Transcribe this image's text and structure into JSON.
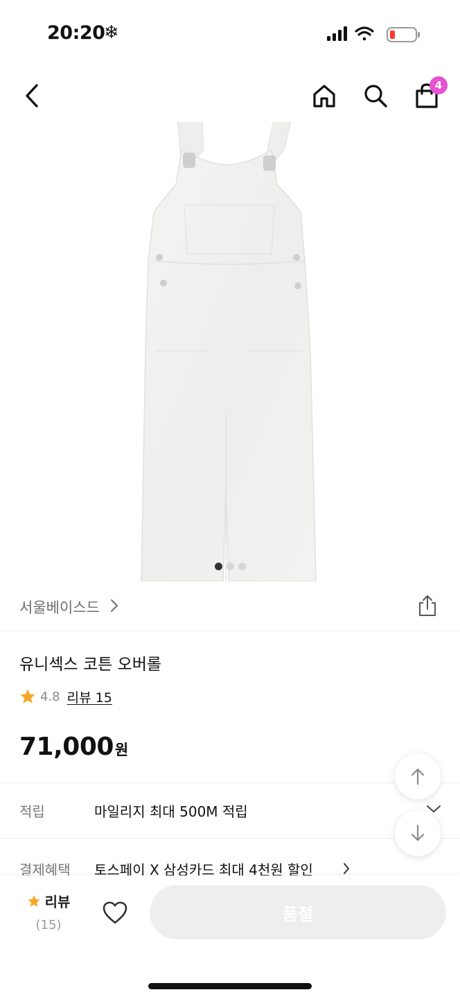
{
  "status_bar": {
    "time": "20:20",
    "snow_glyph": "❄"
  },
  "nav": {
    "cart_count": "4",
    "badge_color": "#e553d0"
  },
  "gallery": {
    "total": 3,
    "active_index": 0
  },
  "brand": {
    "name": "서울베이스드"
  },
  "product": {
    "title": "유니섹스 코튼 오버롤",
    "rating": "4.8",
    "review_link": "리뷰 15",
    "price": "71,000",
    "price_unit": "원"
  },
  "info": {
    "mileage_label": "적립",
    "mileage_value": "마일리지 최대 500M 적립",
    "payment_label": "결제혜택",
    "payment_value": "토스페이 X 삼성카드 최대 4천원 할인"
  },
  "bottom_bar": {
    "review_label": "리뷰",
    "review_count": "(15)",
    "buy_label": "품절"
  },
  "colors": {
    "star": "#f5a623",
    "disabled_button": "#eeeeee"
  }
}
